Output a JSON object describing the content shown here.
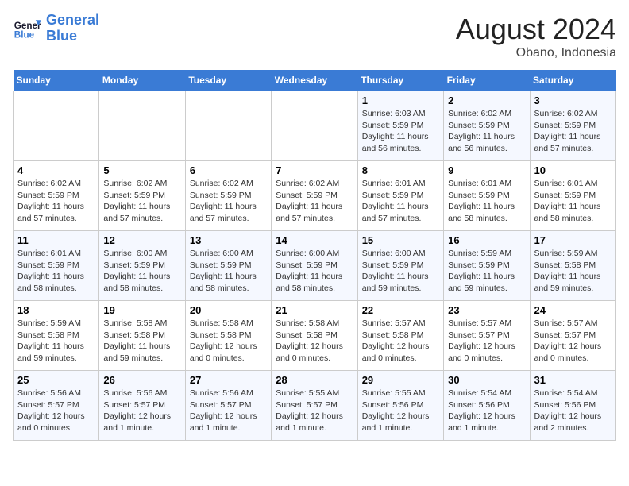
{
  "logo": {
    "line1": "General",
    "line2": "Blue"
  },
  "title": "August 2024",
  "location": "Obano, Indonesia",
  "days_header": [
    "Sunday",
    "Monday",
    "Tuesday",
    "Wednesday",
    "Thursday",
    "Friday",
    "Saturday"
  ],
  "weeks": [
    [
      {
        "num": "",
        "info": ""
      },
      {
        "num": "",
        "info": ""
      },
      {
        "num": "",
        "info": ""
      },
      {
        "num": "",
        "info": ""
      },
      {
        "num": "1",
        "info": "Sunrise: 6:03 AM\nSunset: 5:59 PM\nDaylight: 11 hours\nand 56 minutes."
      },
      {
        "num": "2",
        "info": "Sunrise: 6:02 AM\nSunset: 5:59 PM\nDaylight: 11 hours\nand 56 minutes."
      },
      {
        "num": "3",
        "info": "Sunrise: 6:02 AM\nSunset: 5:59 PM\nDaylight: 11 hours\nand 57 minutes."
      }
    ],
    [
      {
        "num": "4",
        "info": "Sunrise: 6:02 AM\nSunset: 5:59 PM\nDaylight: 11 hours\nand 57 minutes."
      },
      {
        "num": "5",
        "info": "Sunrise: 6:02 AM\nSunset: 5:59 PM\nDaylight: 11 hours\nand 57 minutes."
      },
      {
        "num": "6",
        "info": "Sunrise: 6:02 AM\nSunset: 5:59 PM\nDaylight: 11 hours\nand 57 minutes."
      },
      {
        "num": "7",
        "info": "Sunrise: 6:02 AM\nSunset: 5:59 PM\nDaylight: 11 hours\nand 57 minutes."
      },
      {
        "num": "8",
        "info": "Sunrise: 6:01 AM\nSunset: 5:59 PM\nDaylight: 11 hours\nand 57 minutes."
      },
      {
        "num": "9",
        "info": "Sunrise: 6:01 AM\nSunset: 5:59 PM\nDaylight: 11 hours\nand 58 minutes."
      },
      {
        "num": "10",
        "info": "Sunrise: 6:01 AM\nSunset: 5:59 PM\nDaylight: 11 hours\nand 58 minutes."
      }
    ],
    [
      {
        "num": "11",
        "info": "Sunrise: 6:01 AM\nSunset: 5:59 PM\nDaylight: 11 hours\nand 58 minutes."
      },
      {
        "num": "12",
        "info": "Sunrise: 6:00 AM\nSunset: 5:59 PM\nDaylight: 11 hours\nand 58 minutes."
      },
      {
        "num": "13",
        "info": "Sunrise: 6:00 AM\nSunset: 5:59 PM\nDaylight: 11 hours\nand 58 minutes."
      },
      {
        "num": "14",
        "info": "Sunrise: 6:00 AM\nSunset: 5:59 PM\nDaylight: 11 hours\nand 58 minutes."
      },
      {
        "num": "15",
        "info": "Sunrise: 6:00 AM\nSunset: 5:59 PM\nDaylight: 11 hours\nand 59 minutes."
      },
      {
        "num": "16",
        "info": "Sunrise: 5:59 AM\nSunset: 5:59 PM\nDaylight: 11 hours\nand 59 minutes."
      },
      {
        "num": "17",
        "info": "Sunrise: 5:59 AM\nSunset: 5:58 PM\nDaylight: 11 hours\nand 59 minutes."
      }
    ],
    [
      {
        "num": "18",
        "info": "Sunrise: 5:59 AM\nSunset: 5:58 PM\nDaylight: 11 hours\nand 59 minutes."
      },
      {
        "num": "19",
        "info": "Sunrise: 5:58 AM\nSunset: 5:58 PM\nDaylight: 11 hours\nand 59 minutes."
      },
      {
        "num": "20",
        "info": "Sunrise: 5:58 AM\nSunset: 5:58 PM\nDaylight: 12 hours\nand 0 minutes."
      },
      {
        "num": "21",
        "info": "Sunrise: 5:58 AM\nSunset: 5:58 PM\nDaylight: 12 hours\nand 0 minutes."
      },
      {
        "num": "22",
        "info": "Sunrise: 5:57 AM\nSunset: 5:58 PM\nDaylight: 12 hours\nand 0 minutes."
      },
      {
        "num": "23",
        "info": "Sunrise: 5:57 AM\nSunset: 5:57 PM\nDaylight: 12 hours\nand 0 minutes."
      },
      {
        "num": "24",
        "info": "Sunrise: 5:57 AM\nSunset: 5:57 PM\nDaylight: 12 hours\nand 0 minutes."
      }
    ],
    [
      {
        "num": "25",
        "info": "Sunrise: 5:56 AM\nSunset: 5:57 PM\nDaylight: 12 hours\nand 0 minutes."
      },
      {
        "num": "26",
        "info": "Sunrise: 5:56 AM\nSunset: 5:57 PM\nDaylight: 12 hours\nand 1 minute."
      },
      {
        "num": "27",
        "info": "Sunrise: 5:56 AM\nSunset: 5:57 PM\nDaylight: 12 hours\nand 1 minute."
      },
      {
        "num": "28",
        "info": "Sunrise: 5:55 AM\nSunset: 5:57 PM\nDaylight: 12 hours\nand 1 minute."
      },
      {
        "num": "29",
        "info": "Sunrise: 5:55 AM\nSunset: 5:56 PM\nDaylight: 12 hours\nand 1 minute."
      },
      {
        "num": "30",
        "info": "Sunrise: 5:54 AM\nSunset: 5:56 PM\nDaylight: 12 hours\nand 1 minute."
      },
      {
        "num": "31",
        "info": "Sunrise: 5:54 AM\nSunset: 5:56 PM\nDaylight: 12 hours\nand 2 minutes."
      }
    ]
  ]
}
